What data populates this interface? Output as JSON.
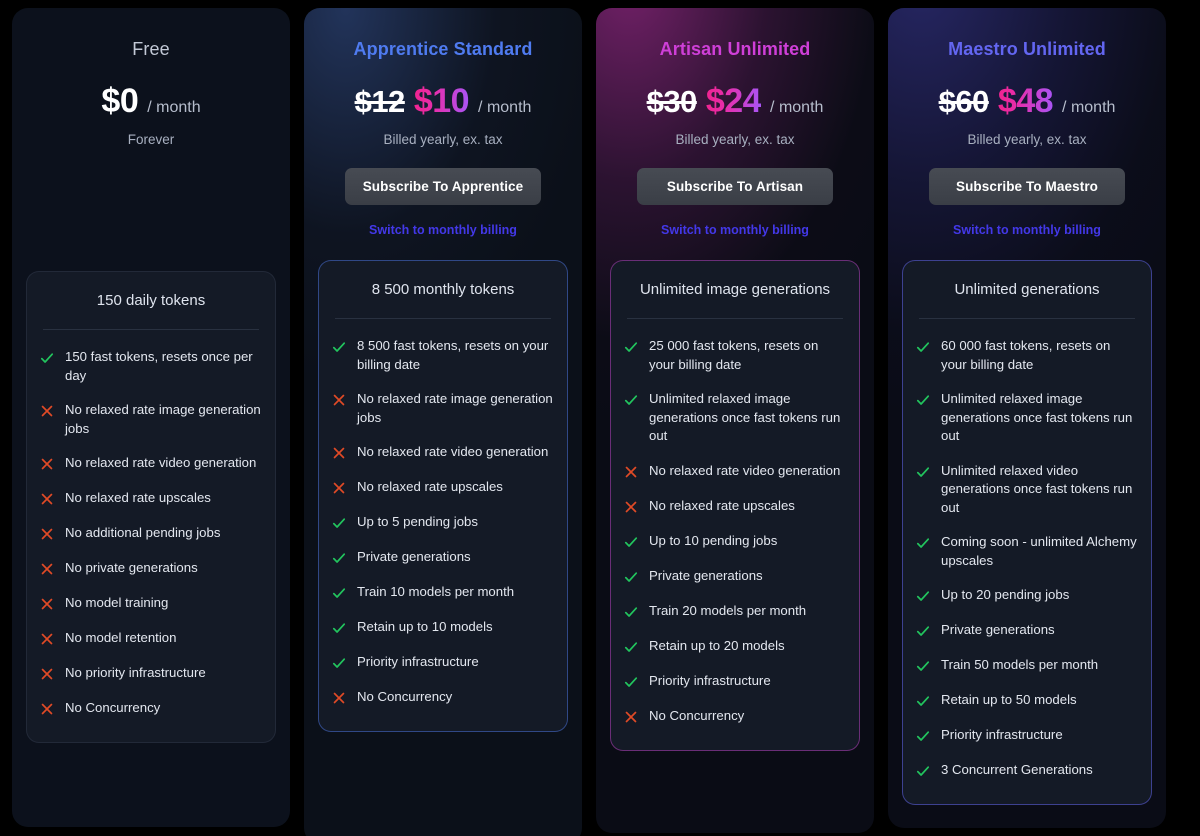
{
  "plans": [
    {
      "id": "free",
      "name": "Free",
      "price_current": "$0",
      "price_old": null,
      "period": "/ month",
      "billing_note": "Forever",
      "cta_label": null,
      "switch_label": null,
      "accent": "#c3c9d6",
      "features_title": "150 daily tokens",
      "features": [
        {
          "ok": true,
          "text": "150 fast tokens, resets once per day"
        },
        {
          "ok": false,
          "text": "No relaxed rate image generation jobs"
        },
        {
          "ok": false,
          "text": "No relaxed rate video generation"
        },
        {
          "ok": false,
          "text": "No relaxed rate upscales"
        },
        {
          "ok": false,
          "text": "No additional pending jobs"
        },
        {
          "ok": false,
          "text": "No private generations"
        },
        {
          "ok": false,
          "text": "No model training"
        },
        {
          "ok": false,
          "text": "No model retention"
        },
        {
          "ok": false,
          "text": "No priority infrastructure"
        },
        {
          "ok": false,
          "text": "No Concurrency"
        }
      ]
    },
    {
      "id": "apprentice",
      "name": "Apprentice Standard",
      "price_current": "$10",
      "price_old": "$12",
      "period": "/ month",
      "billing_note": "Billed yearly, ex. tax",
      "cta_label": "Subscribe To Apprentice",
      "switch_label": "Switch to monthly billing",
      "accent": "#4f7bf0",
      "features_title": "8 500 monthly tokens",
      "features": [
        {
          "ok": true,
          "text": "8 500 fast tokens, resets on your billing date"
        },
        {
          "ok": false,
          "text": "No relaxed rate image generation jobs"
        },
        {
          "ok": false,
          "text": "No relaxed rate video generation"
        },
        {
          "ok": false,
          "text": "No relaxed rate upscales"
        },
        {
          "ok": true,
          "text": "Up to 5 pending jobs"
        },
        {
          "ok": true,
          "text": "Private generations"
        },
        {
          "ok": true,
          "text": "Train 10 models per month"
        },
        {
          "ok": true,
          "text": "Retain up to 10 models"
        },
        {
          "ok": true,
          "text": "Priority infrastructure"
        },
        {
          "ok": false,
          "text": "No Concurrency"
        }
      ]
    },
    {
      "id": "artisan",
      "name": "Artisan Unlimited",
      "price_current": "$24",
      "price_old": "$30",
      "period": "/ month",
      "billing_note": "Billed yearly, ex. tax",
      "cta_label": "Subscribe To Artisan",
      "switch_label": "Switch to monthly billing",
      "accent": "#cf3fd8",
      "features_title": "Unlimited image generations",
      "features": [
        {
          "ok": true,
          "text": "25 000 fast tokens, resets on your billing date"
        },
        {
          "ok": true,
          "text": "Unlimited relaxed image generations once fast tokens run out"
        },
        {
          "ok": false,
          "text": "No relaxed rate video generation"
        },
        {
          "ok": false,
          "text": "No relaxed rate upscales"
        },
        {
          "ok": true,
          "text": "Up to 10 pending jobs"
        },
        {
          "ok": true,
          "text": "Private generations"
        },
        {
          "ok": true,
          "text": "Train 20 models per month"
        },
        {
          "ok": true,
          "text": "Retain up to 20 models"
        },
        {
          "ok": true,
          "text": "Priority infrastructure"
        },
        {
          "ok": false,
          "text": "No Concurrency"
        }
      ]
    },
    {
      "id": "maestro",
      "name": "Maestro Unlimited",
      "price_current": "$48",
      "price_old": "$60",
      "period": "/ month",
      "billing_note": "Billed yearly, ex. tax",
      "cta_label": "Subscribe To Maestro",
      "switch_label": "Switch to monthly billing",
      "accent": "#6366f1",
      "features_title": "Unlimited generations",
      "features": [
        {
          "ok": true,
          "text": "60 000 fast tokens, resets on your billing date"
        },
        {
          "ok": true,
          "text": "Unlimited relaxed image generations once fast tokens run out"
        },
        {
          "ok": true,
          "text": "Unlimited relaxed video generations once fast tokens run out"
        },
        {
          "ok": true,
          "text": "Coming soon - unlimited Alchemy upscales"
        },
        {
          "ok": true,
          "text": "Up to 20 pending jobs"
        },
        {
          "ok": true,
          "text": "Private generations"
        },
        {
          "ok": true,
          "text": "Train 50 models per month"
        },
        {
          "ok": true,
          "text": "Retain up to 50 models"
        },
        {
          "ok": true,
          "text": "Priority infrastructure"
        },
        {
          "ok": true,
          "text": "3 Concurrent Generations"
        }
      ]
    }
  ],
  "icons": {
    "included": "check-icon",
    "excluded": "cross-icon"
  },
  "colors": {
    "page_background": "#000000",
    "card_background": "#0c111c",
    "features_background": "#141a26",
    "check_green": "#22c55e",
    "cross_orange": "#e04a26",
    "price_gradient_start": "#f0238f",
    "price_gradient_end": "#a855f7",
    "cta_background": "#474b53",
    "switch_link": "#4338e8",
    "text_primary": "#e3e7ef",
    "text_muted": "#a8b0c0"
  }
}
